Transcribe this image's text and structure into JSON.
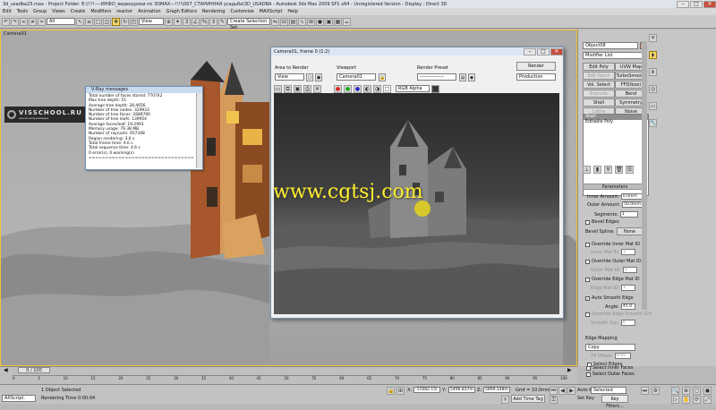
{
  "window": {
    "title": "3d_usadba23.max    - Project Folder: E:\\!!!!----ИНФО_видеоуроки по 3DMAX---!!!!\\007_СТАРИННАЯ усадьба\\3D_USADBA    - Autodesk 3ds Max  2009 SP1  x64    - Unregistered Version        - Display : Direct 3D",
    "minimize": "–",
    "maximize": "□",
    "close": "✕"
  },
  "menu": [
    "Edit",
    "Tools",
    "Group",
    "Views",
    "Create",
    "Modifiers",
    "reactor",
    "Animation",
    "Graph Editors",
    "Rendering",
    "Customize",
    "MAXScript",
    "Help"
  ],
  "toolbar": {
    "filter": "All",
    "refcoord": "View",
    "selset": "Create Selection Set"
  },
  "viewport": {
    "label": "Camera01"
  },
  "watermark": {
    "text": "VISSCHOOL.RU",
    "sub": "школа визуализации"
  },
  "vray": {
    "title": "V-Ray messages",
    "lines": [
      "Total number of faces stored: 770742",
      "Max tree depth: 51",
      "Average tree depth: 28.4656",
      "Number of tree nodes: 329933",
      "Number of tree faces: 2689790",
      "Number of tree leafs: 139954",
      "Average faces/leaf: 19.2993",
      "Memory usage: 79.38 MB",
      "Number of raycasts: 957348",
      "Region rendering: 3.6 s",
      "Total frame time: 4.6 s",
      "Total sequence time: 4.6 s",
      "0 error(s), 0 warning(s)",
      "================================"
    ]
  },
  "frame_window": {
    "title": "Camera01, frame 0 (1:2)",
    "area_label": "Area to Render",
    "area_value": "View",
    "viewport_label": "Viewport",
    "viewport_value": "Camera01",
    "preset_label": "Render Preset",
    "preset_value": "---------------",
    "render_btn": "Render",
    "production": "Production",
    "channel": "RGB Alpha"
  },
  "overlay_url": "www.cgtsj.com",
  "cmd": {
    "object_name": "Object08",
    "modifier_list": "Modifier List",
    "buttons": [
      "Edit Poly",
      "UVW Map",
      "Edit Patch",
      "TurboSmooth",
      "Vol. Select",
      "FFD(box)",
      "Extrude",
      "Bend",
      "Shell",
      "Symmetry",
      "Lathe",
      "Noise"
    ],
    "stack": [
      "Shell",
      "Editable Poly"
    ],
    "params_title": "Parameters",
    "inner_label": "Inner Amount:",
    "inner_value": "0.0mm",
    "outer_label": "Outer Amount:",
    "outer_value": "50.0mm",
    "segments_label": "Segments:",
    "segments_value": "1",
    "bevel_edges": "Bevel Edges",
    "bevel_spline": "Bevel Spline:",
    "none_btn": "None",
    "override_inner": "Override Inner Mat ID",
    "inner_mat": "Inner Mat ID:",
    "inner_mat_val": "1",
    "override_outer": "Override Outer Mat ID",
    "outer_mat": "Outer Mat ID:",
    "outer_mat_val": "1",
    "override_edge": "Override Edge Mat ID",
    "edge_mat": "Edge Mat ID:",
    "edge_mat_val": "1",
    "auto_smooth": "Auto Smooth Edge",
    "angle_label": "Angle:",
    "angle_value": "45.0",
    "override_smooth": "Override Edge Smooth Gro",
    "smooth_grp": "Smooth Grp:",
    "smooth_grp_val": "0",
    "edge_mapping": "Edge Mapping",
    "mapping_value": "Copy",
    "tv_offset": "TV Offset:",
    "tv_offset_val": "0.05",
    "select_edges": "Select Edges",
    "select_inner": "Select Inner Faces",
    "select_outer": "Select Outer Faces"
  },
  "timeline": {
    "counter": "0 / 100",
    "ticks": [
      "0",
      "5",
      "10",
      "15",
      "20",
      "25",
      "30",
      "35",
      "40",
      "45",
      "50",
      "55",
      "60",
      "65",
      "70",
      "75",
      "80",
      "85",
      "90",
      "95",
      "100"
    ]
  },
  "status": {
    "script": "AXScript.",
    "selected": "1 Object Selected",
    "render_time": "Rendering Time  0:00:04",
    "x": "-11082.15(",
    "y": "5496.837m",
    "z": "5899.148m",
    "grid": "Grid = 10.0mm",
    "add_time_tag": "Add Time Tag",
    "auto_key": "Auto Key",
    "set_key": "Set Key",
    "selected_dd": "Selected",
    "key_filters": "Key Filters..."
  }
}
